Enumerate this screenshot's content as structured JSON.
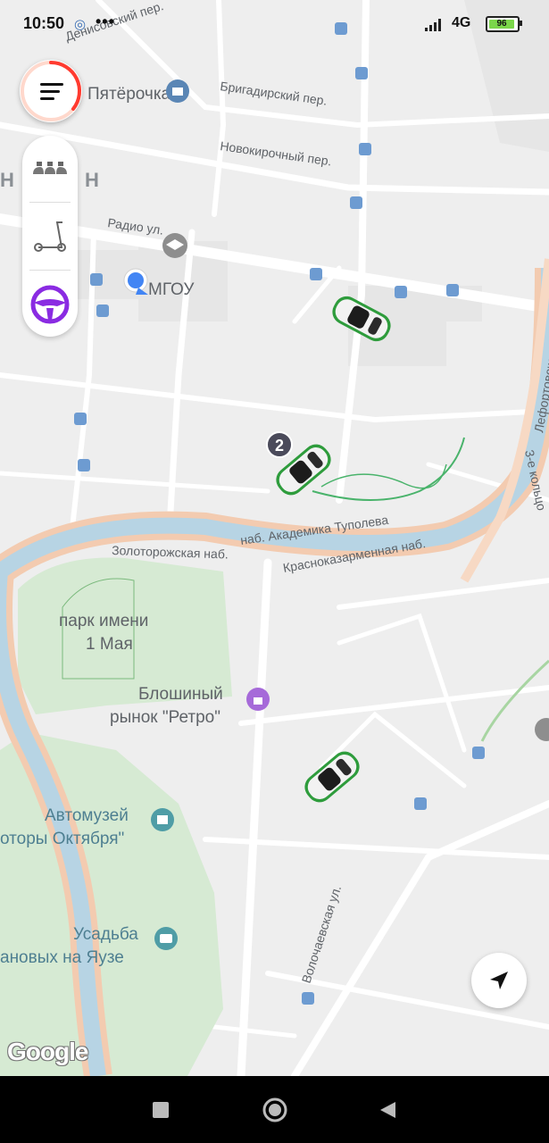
{
  "status_bar": {
    "time": "10:50",
    "left_icons": [
      "app-notification-icon",
      "more-dots-icon"
    ],
    "network": "4G",
    "battery": "96",
    "battery_level": 0.96
  },
  "map": {
    "labels": [
      {
        "text": "Денисовский пер.",
        "kind": "street"
      },
      {
        "text": "Пятёрочка",
        "kind": "big"
      },
      {
        "text": "Бригадирский пер.",
        "kind": "street"
      },
      {
        "text": "Новокирочный пер.",
        "kind": "street"
      },
      {
        "text": "Н",
        "kind": "big"
      },
      {
        "text": "Н",
        "kind": "big"
      },
      {
        "text": "Радио ул.",
        "kind": "street"
      },
      {
        "text": "МГОУ",
        "kind": "big"
      },
      {
        "text": "наб. Академика Туполева",
        "kind": "street"
      },
      {
        "text": "Золоторожская наб.",
        "kind": "street"
      },
      {
        "text": "Красноказарменная наб.",
        "kind": "street"
      },
      {
        "text": "Лефортовская наб.",
        "kind": "street"
      },
      {
        "text": "3-е кольцо",
        "kind": "street"
      },
      {
        "text": "парк имени",
        "kind": "big"
      },
      {
        "text": "1 Мая",
        "kind": "big"
      },
      {
        "text": "Блошиный",
        "kind": "big"
      },
      {
        "text": "рынок \"Ретро\"",
        "kind": "big"
      },
      {
        "text": "Автомузей",
        "kind": "big"
      },
      {
        "text": "оторы Октября\"",
        "kind": "big"
      },
      {
        "text": "Усадьба",
        "kind": "big"
      },
      {
        "text": "ановых на Яузе",
        "kind": "big"
      },
      {
        "text": "Волочаевская ул.",
        "kind": "street"
      }
    ],
    "cluster_count": "2",
    "attribution": "Google"
  },
  "controls": {
    "menu_icon": "hamburger-menu-icon",
    "menu_ring_color": "#ff3b30",
    "modes": [
      {
        "name": "taxi-mode",
        "icon": "taxi-roof-icon"
      },
      {
        "name": "scooter-mode",
        "icon": "scooter-icon"
      },
      {
        "name": "drive-mode",
        "icon": "steering-wheel-icon",
        "color": "#8a2be2"
      }
    ],
    "locate_icon": "navigation-arrow-icon"
  },
  "nav_bar": {
    "buttons": [
      "recent-apps-icon",
      "home-icon",
      "back-icon"
    ]
  },
  "colors": {
    "river": "#b7d4e4",
    "river_bank": "#f3cbb0",
    "park": "#cfe8cd",
    "car_accent": "#2e9c3c"
  }
}
